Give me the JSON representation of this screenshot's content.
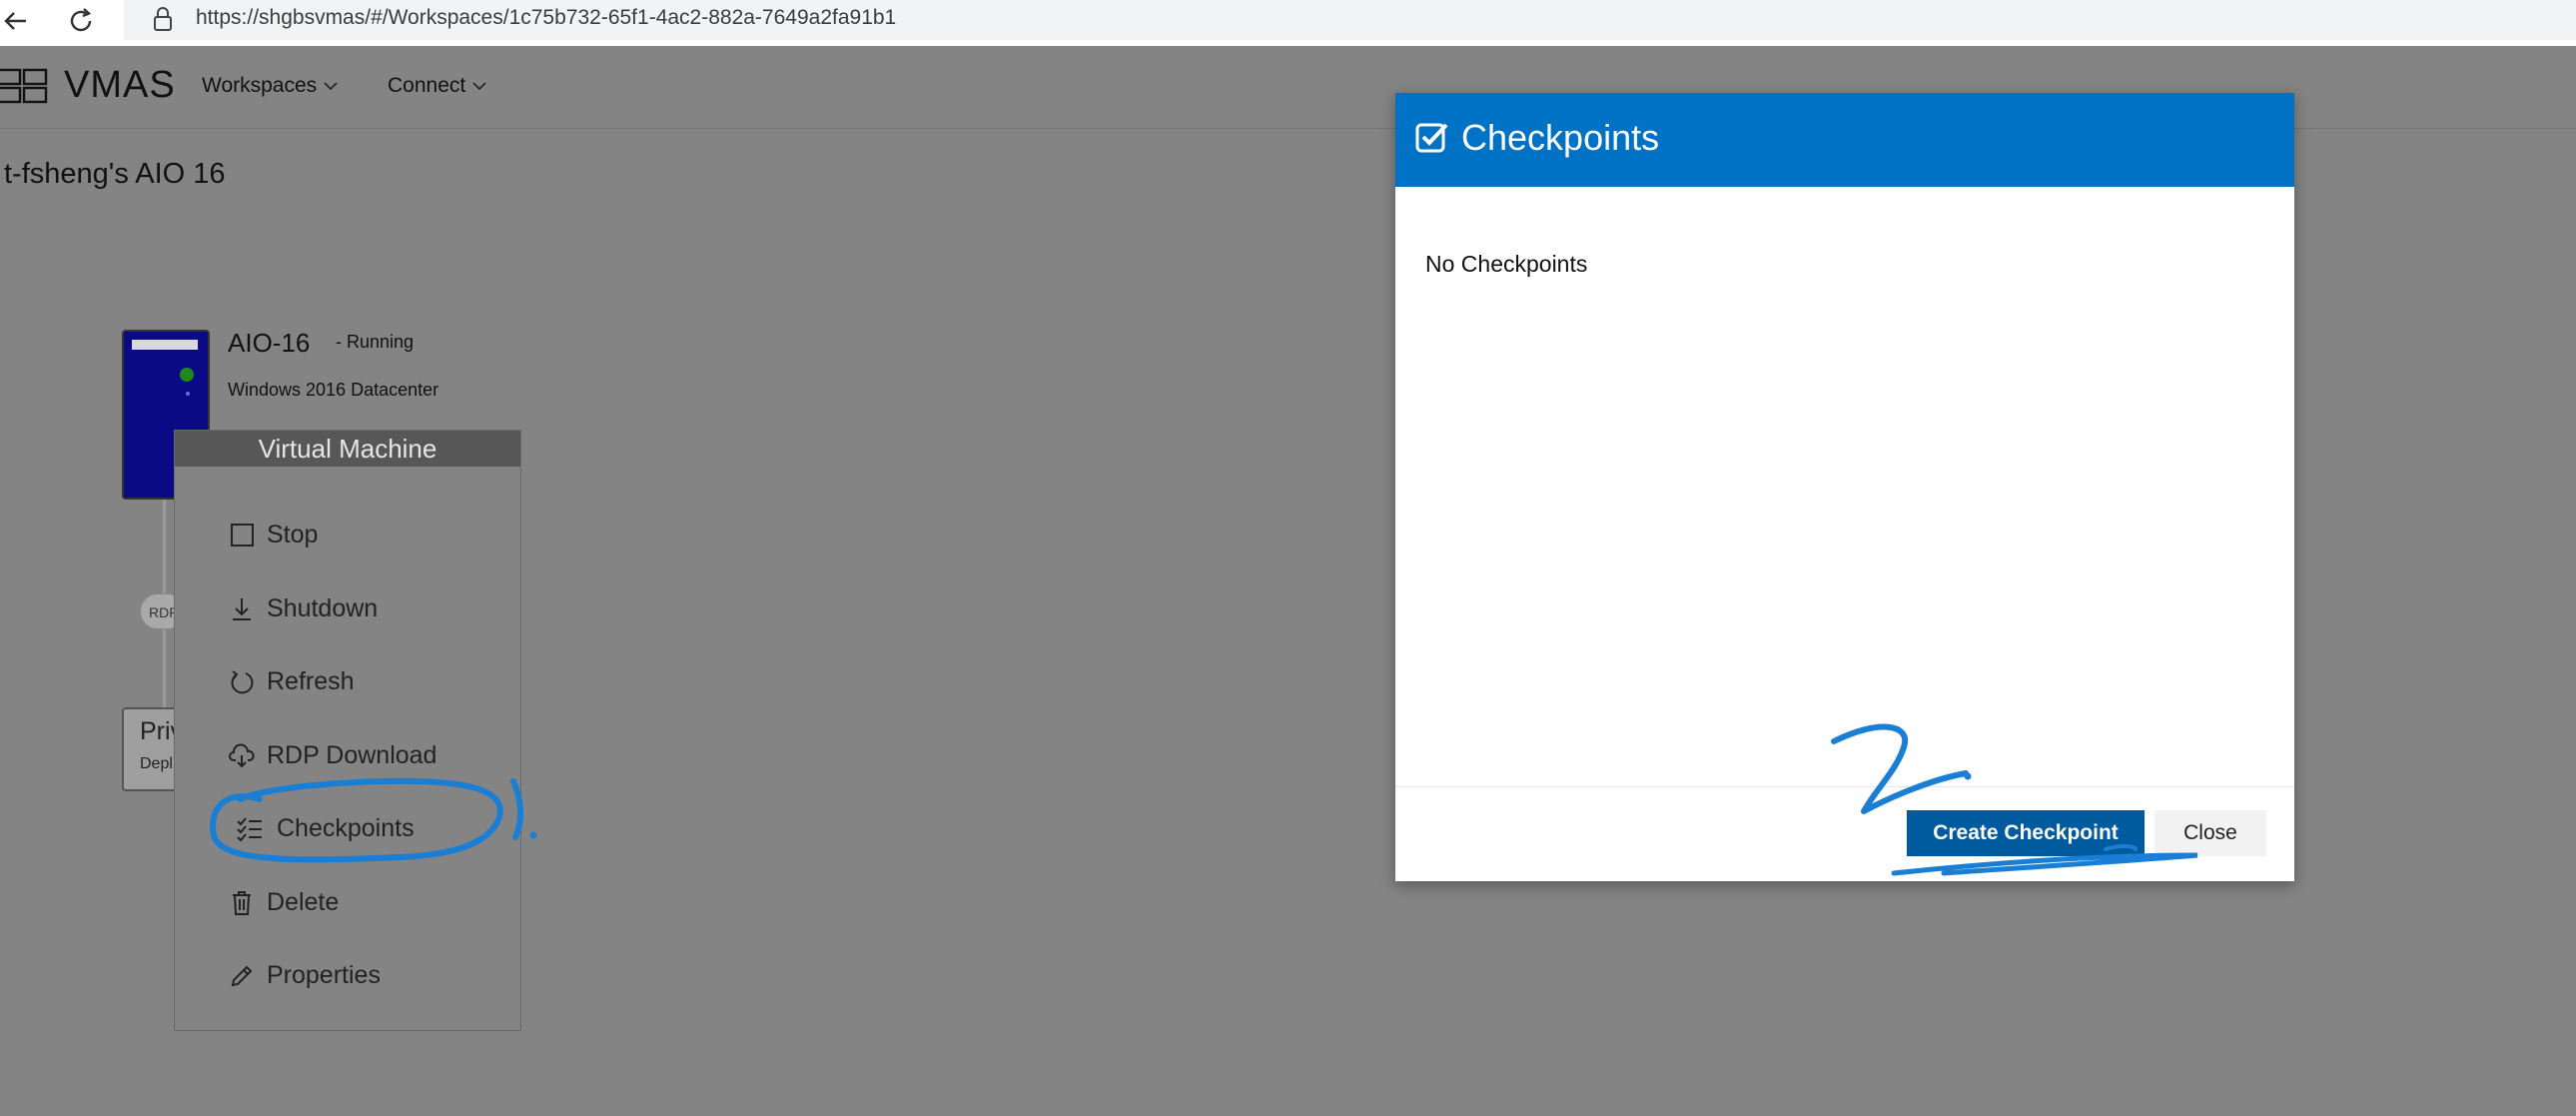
{
  "browser": {
    "url": "https://shgbsvmas/#/Workspaces/1c75b732-65f1-4ac2-882a-7649a2fa91b1",
    "icons": [
      "back-arrow-icon",
      "reload-icon",
      "lock-icon"
    ]
  },
  "header": {
    "brand": "VMAS",
    "nav": [
      {
        "label": "Workspaces",
        "icon": "chevron-down-icon"
      },
      {
        "label": "Connect",
        "icon": "chevron-down-icon"
      }
    ]
  },
  "workspace": {
    "title": "t-fsheng's AIO 16",
    "vm": {
      "name": "AIO-16",
      "status": "- Running",
      "os": "Windows 2016 Datacenter"
    },
    "rdp_label": "RDP",
    "network": {
      "title": "Priv",
      "subtitle": "Depl"
    }
  },
  "context_menu": {
    "title": "Virtual Machine",
    "items": [
      {
        "label": "Stop",
        "icon": "square-icon"
      },
      {
        "label": "Shutdown",
        "icon": "download-arrow-icon"
      },
      {
        "label": "Refresh",
        "icon": "refresh-icon"
      },
      {
        "label": "RDP Download",
        "icon": "cloud-download-icon"
      },
      {
        "label": "Checkpoints",
        "icon": "checklist-icon"
      },
      {
        "label": "Delete",
        "icon": "trash-icon"
      },
      {
        "label": "Properties",
        "icon": "pencil-icon"
      }
    ]
  },
  "modal": {
    "title": "Checkpoints",
    "icon": "checkbox-checked-icon",
    "empty_message": "No Checkpoints",
    "primary_button": "Create Checkpoint",
    "secondary_button": "Close"
  },
  "annotations": {
    "marker_1": "1.",
    "marker_2": "2.",
    "color": "#1a7fd4"
  },
  "colors": {
    "modal_header": "#0072c6",
    "primary_button": "#005a9e",
    "overlay": "#848484",
    "vm_icon": "#0a0a84"
  }
}
